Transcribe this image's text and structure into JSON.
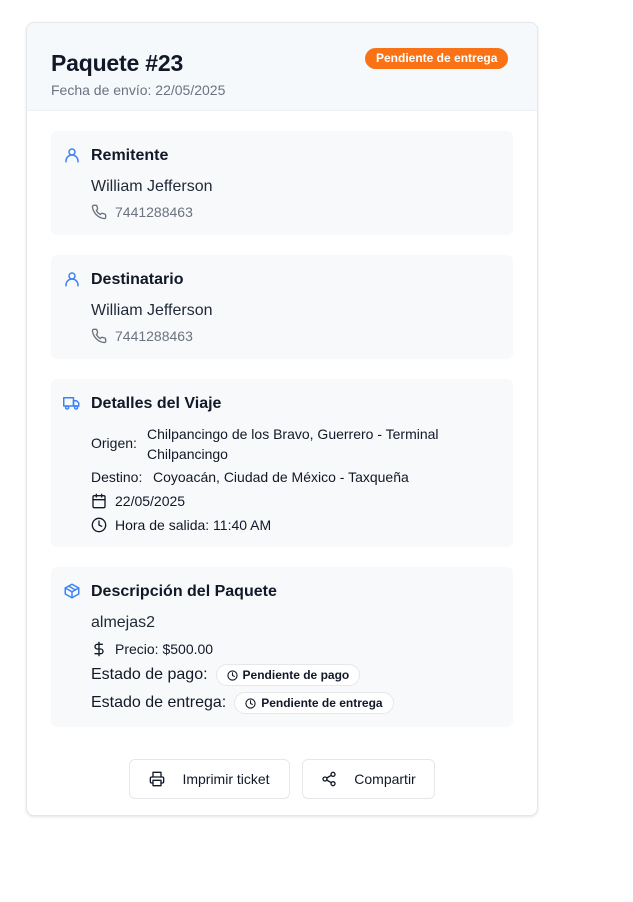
{
  "header": {
    "title": "Paquete #23",
    "date": "Fecha de envío: 22/05/2025",
    "status_badge": "Pendiente de entrega",
    "status_color": "#f97316"
  },
  "sender": {
    "title": "Remitente",
    "name": "William Jefferson",
    "phone": "7441288463",
    "icon": "user-icon"
  },
  "recipient": {
    "title": "Destinatario",
    "name": "William Jefferson",
    "phone": "7441288463",
    "icon": "user-icon"
  },
  "trip": {
    "title": "Detalles del Viaje",
    "icon": "truck-icon",
    "origin_label": "Origen:",
    "origin": "Chilpancingo de los Bravo, Guerrero - Terminal Chilpancingo",
    "destination_label": "Destino:",
    "destination": "Coyoacán, Ciudad de México - Taxqueña",
    "date": "22/05/2025",
    "departure": "Hora de salida: 11:40 AM"
  },
  "package": {
    "title": "Descripción del Paquete",
    "icon": "package-icon",
    "description": "almejas2",
    "price": "Precio: $500.00",
    "payment_label": "Estado de pago:",
    "payment_status": "Pendiente de pago",
    "delivery_label": "Estado de entrega:",
    "delivery_status": "Pendiente de entrega"
  },
  "actions": {
    "print_label": "Imprimir ticket",
    "share_label": "Compartir"
  },
  "colors": {
    "accent_blue": "#3b82f6",
    "section_bg": "#f8f9fb"
  }
}
